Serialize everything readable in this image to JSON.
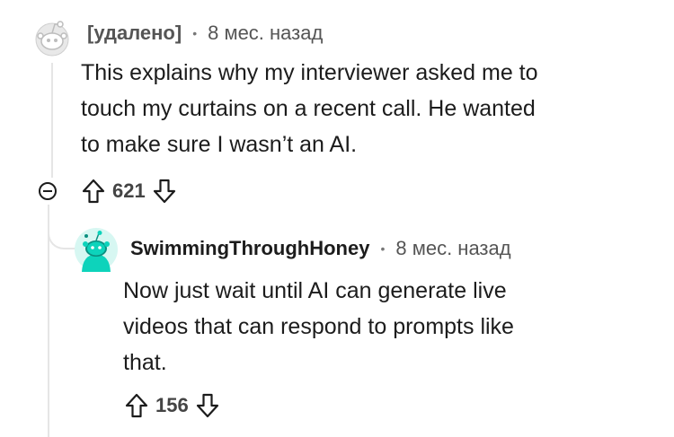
{
  "comments": [
    {
      "author": "[удалено]",
      "separator": "•",
      "time": "8 мес. назад",
      "body_lines": [
        "This explains why my interviewer asked me to",
        "touch my curtains on a recent call. He wanted",
        "to make sure I wasn’t an AI."
      ],
      "score": "621"
    },
    {
      "author": "SwimmingThroughHoney",
      "separator": "•",
      "time": "8 мес. назад",
      "body_lines": [
        "Now just wait until AI can generate live",
        "videos that can respond to prompts like",
        "that."
      ],
      "score": "156"
    }
  ],
  "colors": {
    "avatar_teal": "#0dd3bb",
    "text": "#1c1c1c",
    "meta": "#555555",
    "thread_line": "#e5e5e5"
  },
  "icons": [
    "deleted-user-avatar-icon",
    "snoo-avatar-icon",
    "collapse-icon",
    "upvote-icon",
    "downvote-icon"
  ]
}
